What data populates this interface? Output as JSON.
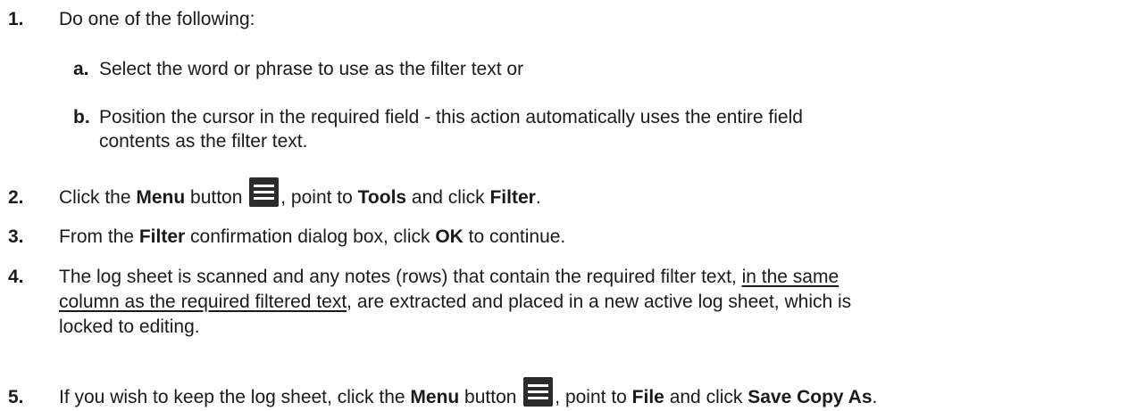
{
  "steps": [
    {
      "num": "1.",
      "text": "Do one of the following:"
    },
    {
      "num": "2.",
      "pre": "Click the ",
      "b1": "Menu",
      "mid1": " button ",
      "mid2": ", point to ",
      "b2": "Tools",
      "mid3": " and click ",
      "b3": "Filter",
      "post": "."
    },
    {
      "num": "3.",
      "pre": "From the ",
      "b1": "Filter",
      "mid1": " confirmation dialog box, click ",
      "b2": "OK",
      "post": " to continue."
    },
    {
      "num": "4.",
      "pre": "The log sheet is scanned and any notes (rows) that contain the required filter text, ",
      "u1": "in the same",
      "u2": "column as the required filtered text",
      "mid": ", are extracted and placed in a new active log sheet, which is",
      "post": "locked to editing."
    },
    {
      "num": "5.",
      "pre": "If you wish to keep the log sheet, click the ",
      "b1": "Menu",
      "mid1": " button ",
      "mid2": ", point to ",
      "b2": "File",
      "mid3": " and click ",
      "b3": "Save Copy As",
      "post": "."
    }
  ],
  "substeps": [
    {
      "label": "a.",
      "text": "Select the word or phrase to use as the filter text or"
    },
    {
      "label": "b.",
      "line1": "Position the cursor in the required field - this action automatically uses the entire field",
      "line2": "contents as the filter text."
    }
  ],
  "icons": {
    "menu": "menu-hamburger-icon"
  }
}
